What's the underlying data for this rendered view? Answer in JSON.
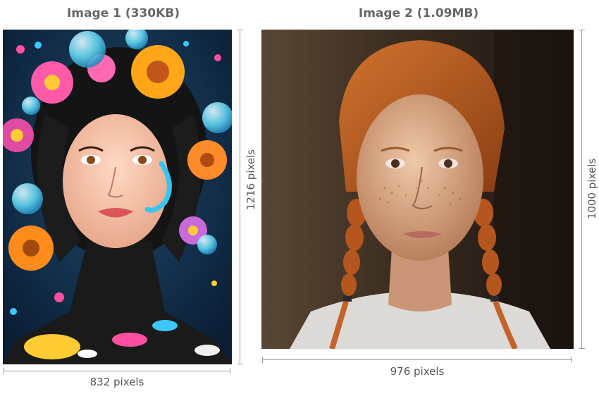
{
  "image1": {
    "title": "Image 1 (330KB)",
    "width_label": "832 pixels",
    "height_label": "1216 pixels",
    "description": "illustrated woman with flowers and bubbles"
  },
  "image2": {
    "title": "Image 2 (1.09MB)",
    "width_label": "976 pixels",
    "height_label": "1000 pixels",
    "description": "photo of red-haired woman with braids"
  },
  "colors": {
    "title_text": "#666666",
    "dimension_line": "#9a9a9a",
    "label_text": "#555555",
    "image1_background": "#0f2a44",
    "image2_background": "#3b2a1e"
  }
}
